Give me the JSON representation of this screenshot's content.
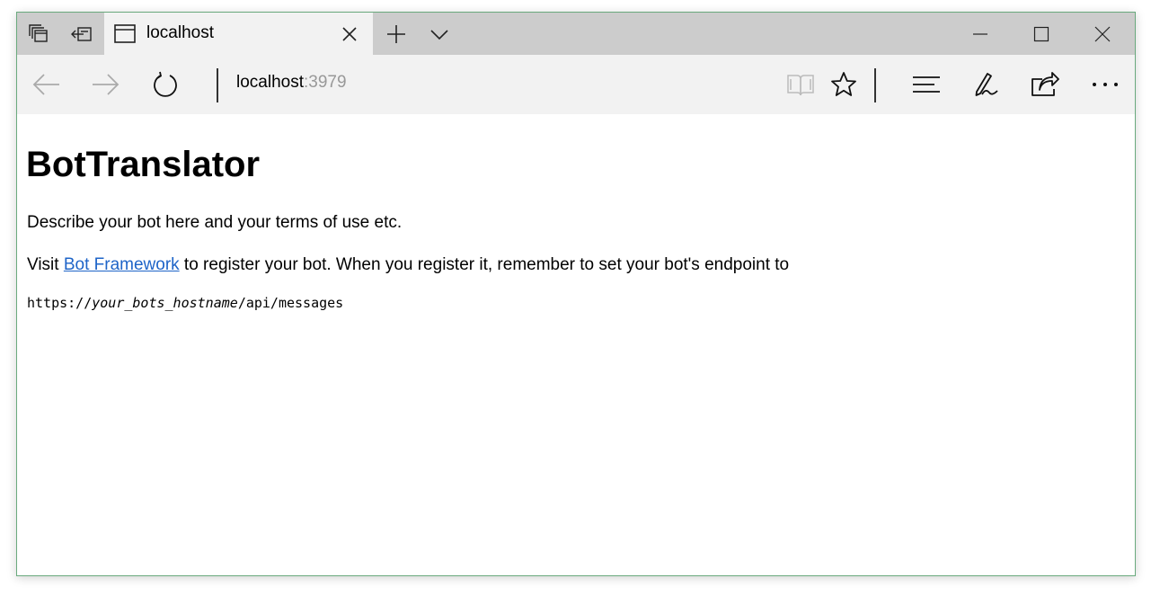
{
  "tab": {
    "title": "localhost"
  },
  "address": {
    "host": "localhost",
    "port": ":3979"
  },
  "page": {
    "heading": "BotTranslator",
    "description": "Describe your bot here and your terms of use etc.",
    "visit_prefix": "Visit ",
    "link_text": "Bot Framework",
    "visit_suffix": " to register your bot. When you register it, remember to set your bot's endpoint to",
    "endpoint_prefix": "https://",
    "endpoint_host": "your_bots_hostname",
    "endpoint_path": "/api/messages"
  },
  "icons": {
    "tab_preview": "tab-preview-icon",
    "set_aside": "set-aside-tabs-icon",
    "tab_page": "page-icon",
    "close_tab": "close-icon",
    "new_tab": "plus-icon",
    "tab_list": "chevron-down-icon",
    "minimize": "minimize-icon",
    "maximize": "maximize-icon",
    "close_window": "close-icon",
    "back": "back-arrow-icon",
    "forward": "forward-arrow-icon",
    "refresh": "refresh-icon",
    "reading_view": "book-icon",
    "favorite": "star-icon",
    "hub": "hub-icon",
    "web_note": "pen-icon",
    "share": "share-icon",
    "more": "more-icon"
  },
  "colors": {
    "window_border": "#6aaa7e",
    "tab_strip": "#cccccc",
    "toolbar": "#f2f2f2",
    "link": "#1e64c8",
    "port_text": "#999999",
    "disabled_icon": "#aaaaaa"
  }
}
